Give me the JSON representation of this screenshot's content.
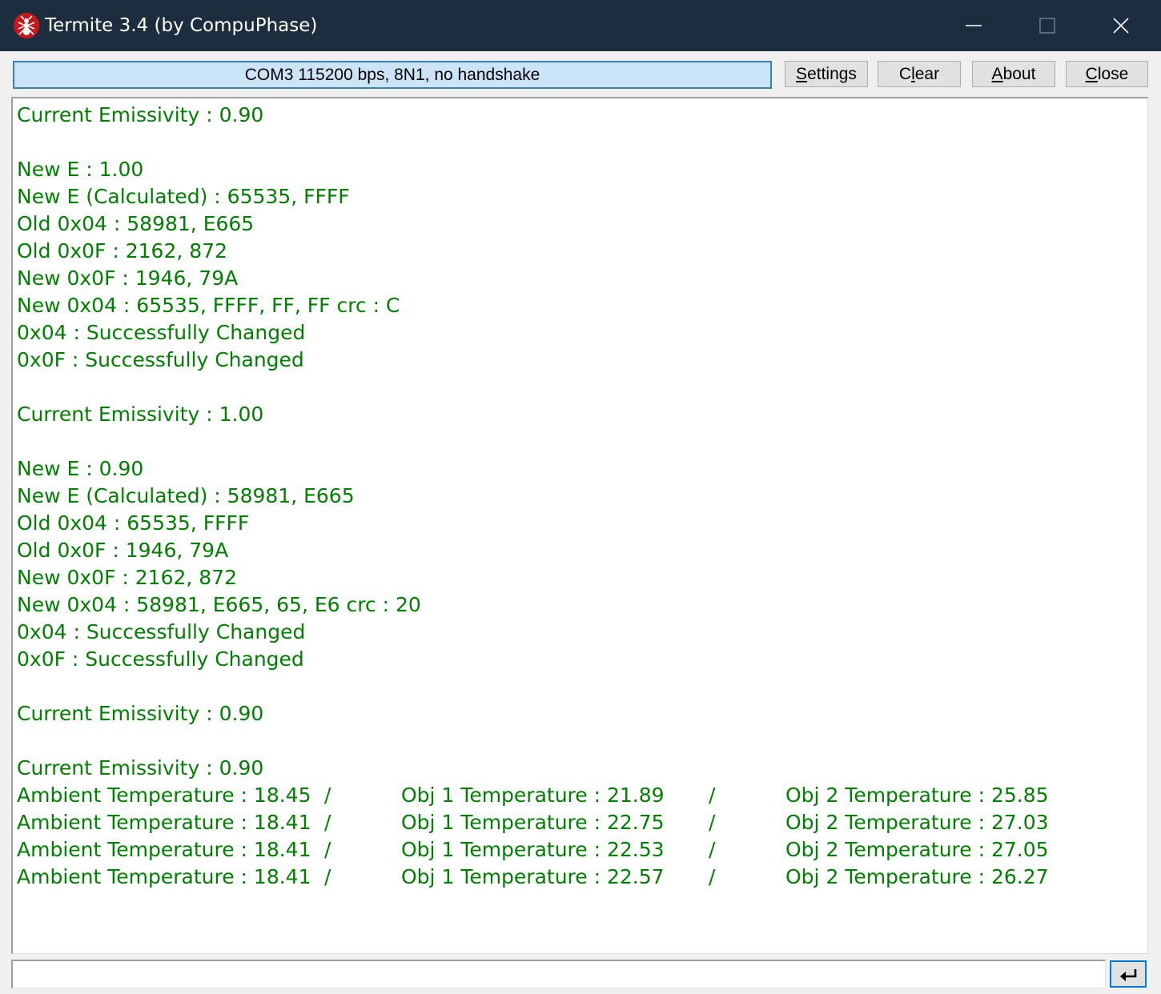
{
  "window": {
    "title": "Termite 3.4 (by CompuPhase)",
    "icon": "ant-icon",
    "controls": [
      "minimize-icon",
      "maximize-icon",
      "close-icon"
    ]
  },
  "toolbar": {
    "status": "COM3 115200 bps, 8N1, no handshake",
    "settings": {
      "mnemonic": "S",
      "rest": "ettings"
    },
    "clear": {
      "pre": "C",
      "mnemonic": "l",
      "rest": "ear"
    },
    "about": {
      "mnemonic": "A",
      "rest": "bout"
    },
    "close": {
      "mnemonic": "C",
      "rest": "lose"
    }
  },
  "log": {
    "text_color": "#008000",
    "lines": [
      "Current Emissivity : 0.90",
      "",
      "New E : 1.00",
      "New E (Calculated) : 65535, FFFF",
      "Old 0x04 : 58981, E665",
      "Old 0x0F : 2162, 872",
      "New 0x0F : 1946, 79A",
      "New 0x04 : 65535, FFFF, FF, FF crc : C",
      "0x04 : Successfully Changed",
      "0x0F : Successfully Changed",
      "",
      "Current Emissivity : 1.00",
      "",
      "New E : 0.90",
      "New E (Calculated) : 58981, E665",
      "Old 0x04 : 65535, FFFF",
      "Old 0x0F : 1946, 79A",
      "New 0x0F : 2162, 872",
      "New 0x04 : 58981, E665, 65, E6 crc : 20",
      "0x04 : Successfully Changed",
      "0x0F : Successfully Changed",
      "",
      "Current Emissivity : 0.90",
      "",
      "Current Emissivity : 0.90"
    ],
    "temperature_rows": [
      [
        "Ambient Temperature : 18.45",
        "/",
        "Obj 1 Temperature : 21.89",
        "/",
        "Obj 2 Temperature : 25.85"
      ],
      [
        "Ambient Temperature : 18.41",
        "/",
        "Obj 1 Temperature : 22.75",
        "/",
        "Obj 2 Temperature : 27.03"
      ],
      [
        "Ambient Temperature : 18.41",
        "/",
        "Obj 1 Temperature : 22.53",
        "/",
        "Obj 2 Temperature : 27.05"
      ],
      [
        "Ambient Temperature : 18.41",
        "/",
        "Obj 1 Temperature : 22.57",
        "/",
        "Obj 2 Temperature : 26.27"
      ]
    ]
  },
  "input": {
    "value": "",
    "send_icon": "enter-icon"
  }
}
